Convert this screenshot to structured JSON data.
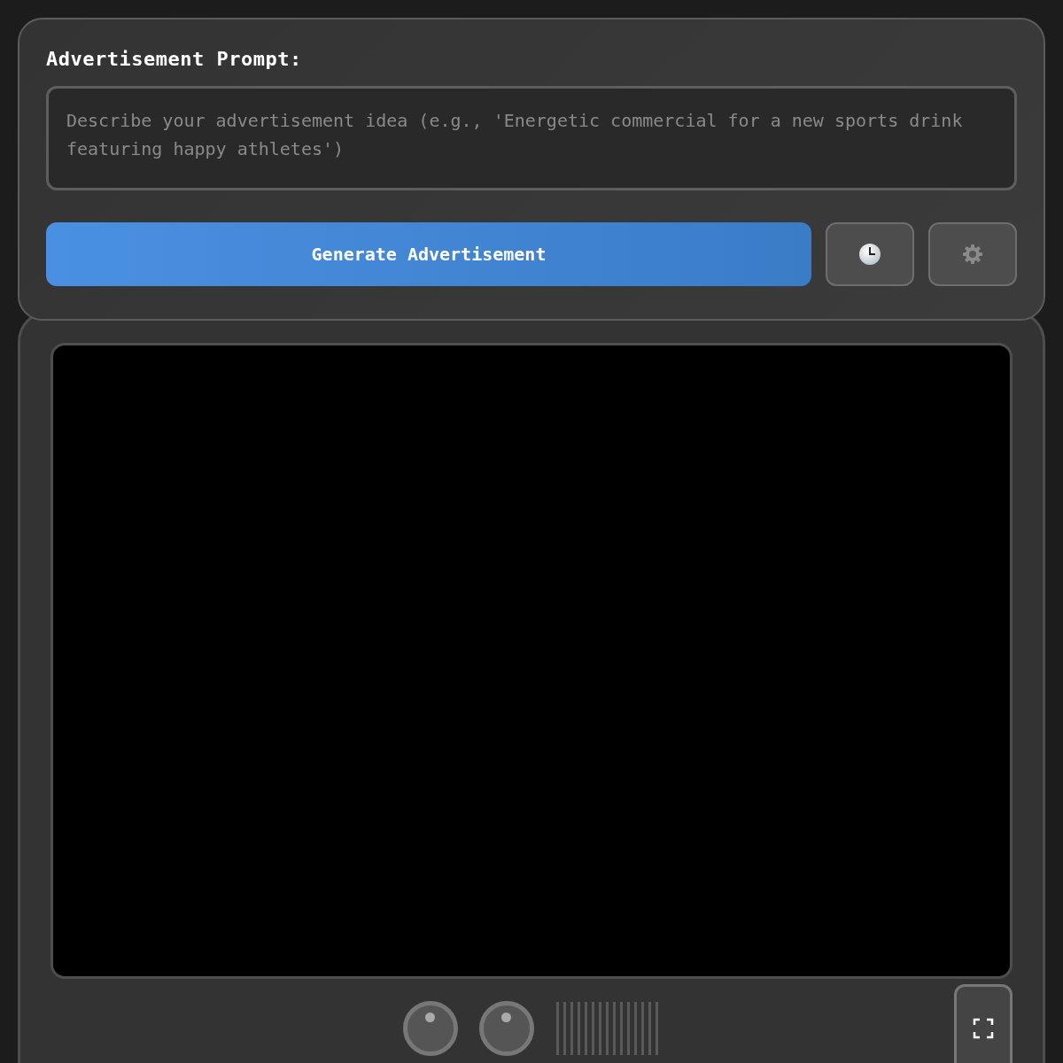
{
  "prompt_panel": {
    "label": "Advertisement Prompt:",
    "placeholder": "Describe your advertisement idea (e.g., 'Energetic commercial for a new sports drink featuring happy athletes')",
    "generate_button": "Generate Advertisement"
  }
}
